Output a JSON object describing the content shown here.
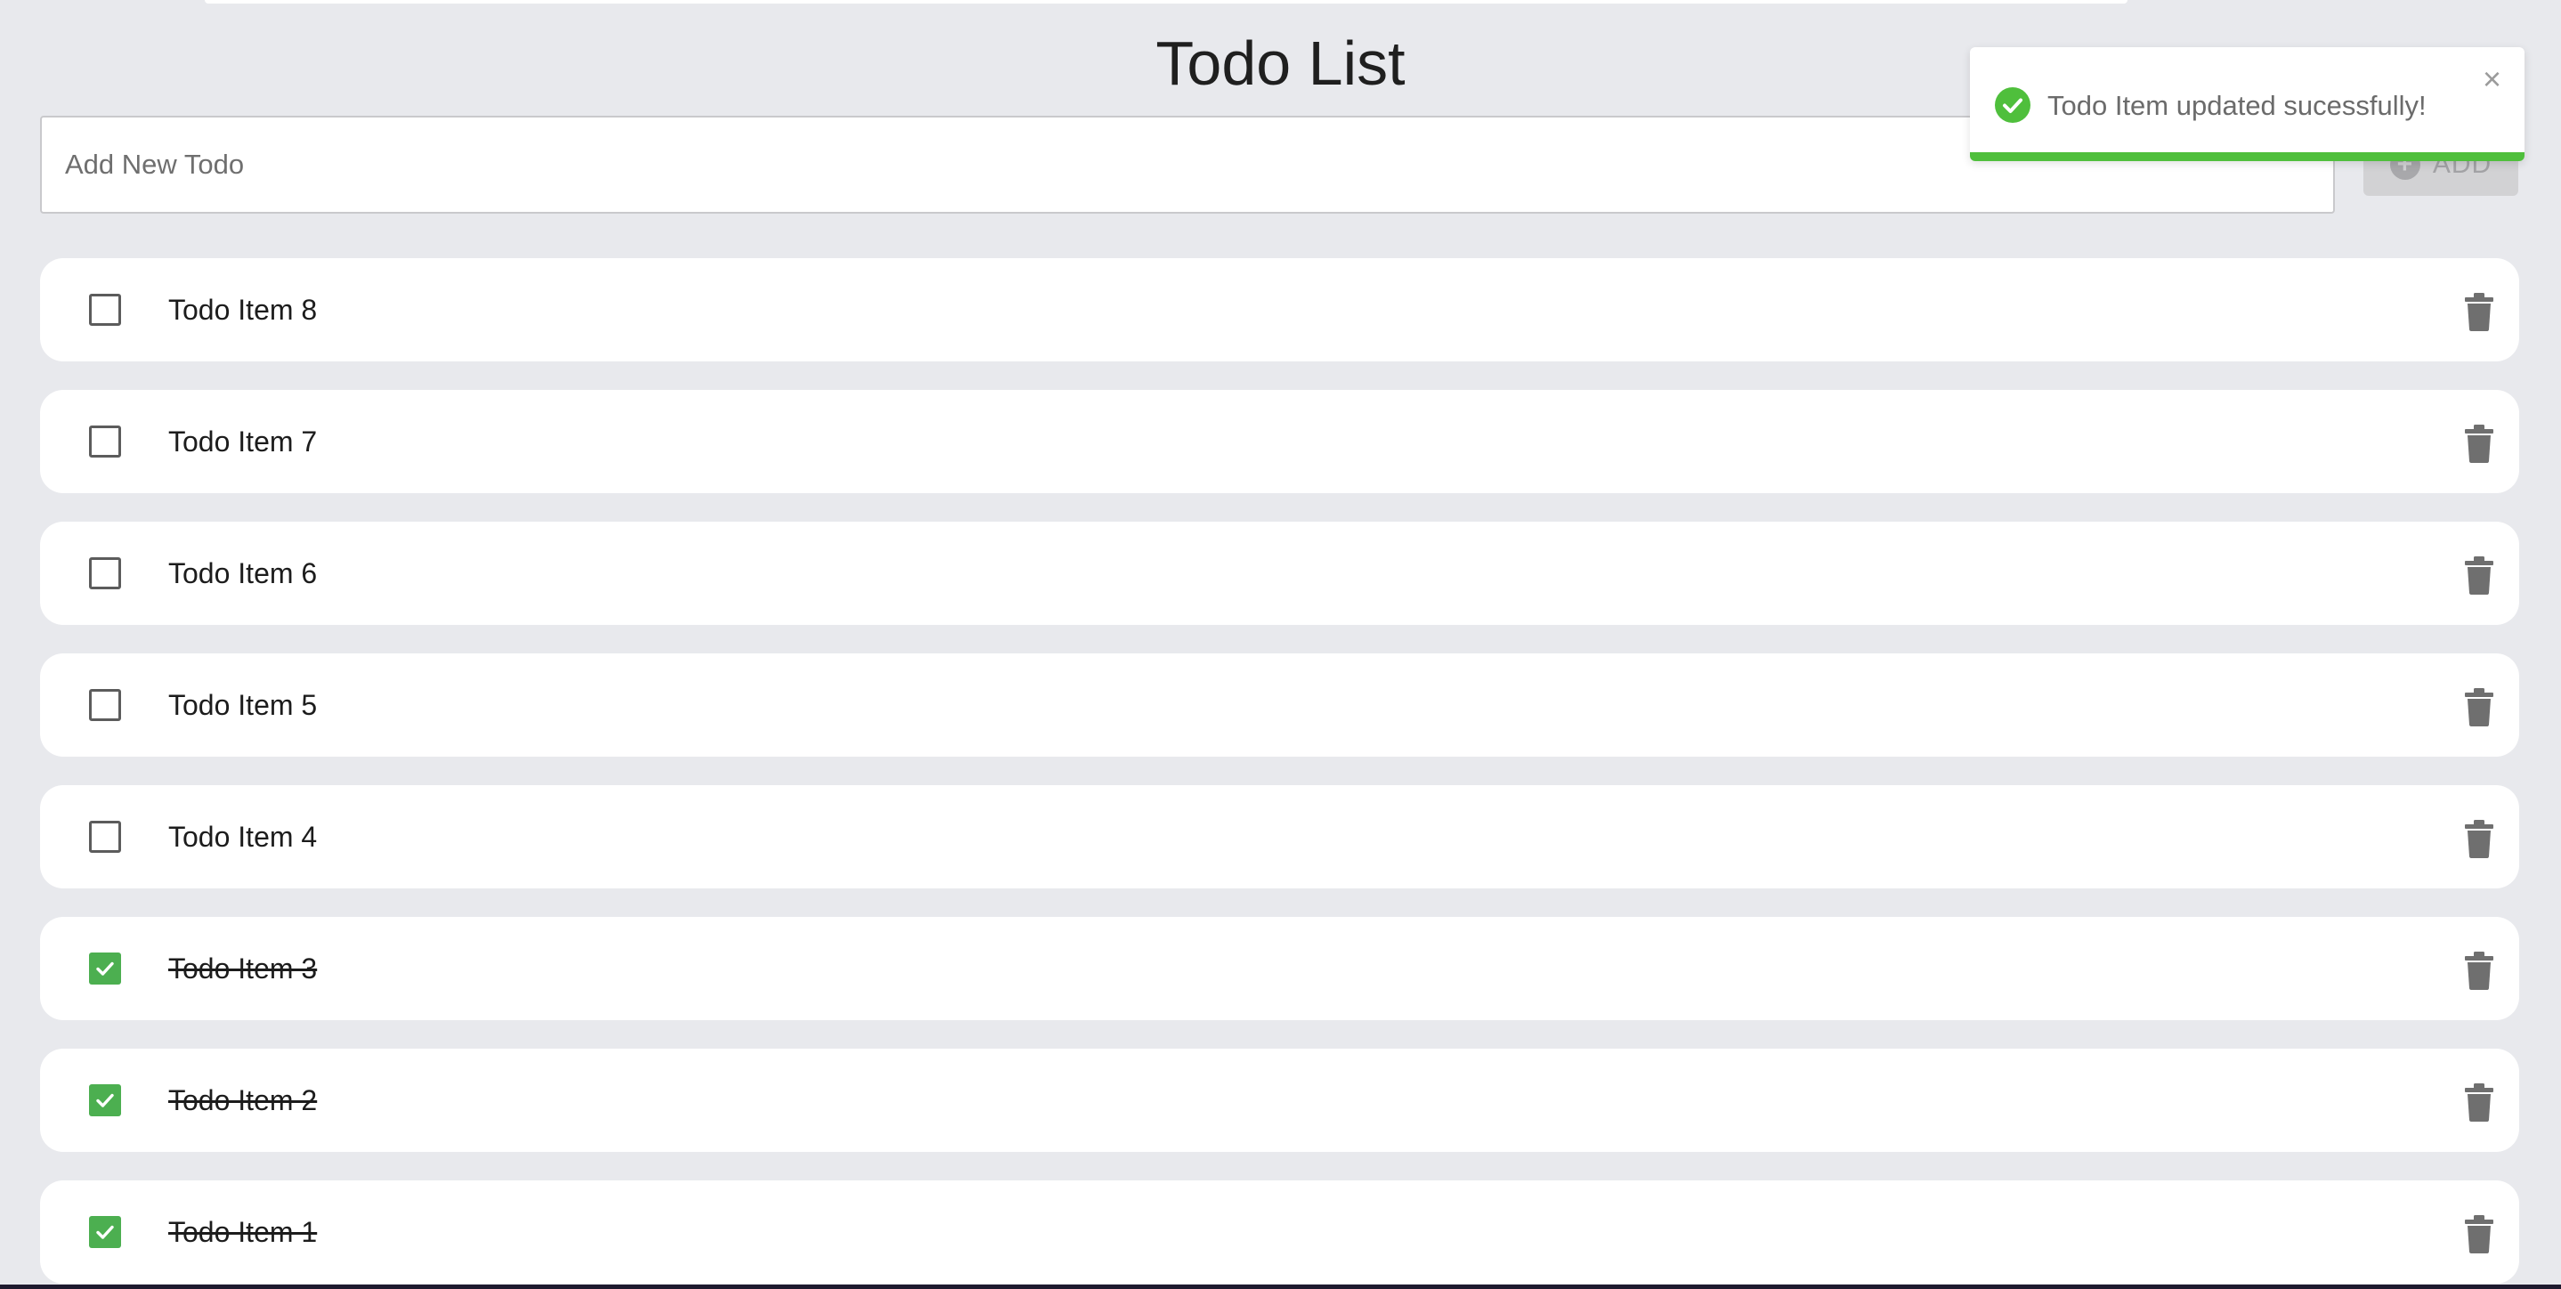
{
  "header": {
    "title": "Todo List"
  },
  "add_form": {
    "placeholder": "Add New Todo",
    "button_label": "ADD",
    "button_icon": "plus-circle-icon"
  },
  "todos": [
    {
      "label": "Todo Item 8",
      "completed": false
    },
    {
      "label": "Todo Item 7",
      "completed": false
    },
    {
      "label": "Todo Item 6",
      "completed": false
    },
    {
      "label": "Todo Item 5",
      "completed": false
    },
    {
      "label": "Todo Item 4",
      "completed": false
    },
    {
      "label": "Todo Item 3",
      "completed": true
    },
    {
      "label": "Todo Item 2",
      "completed": true
    },
    {
      "label": "Todo Item 1",
      "completed": true
    }
  ],
  "toast": {
    "message": "Todo Item updated sucessfully!",
    "close_glyph": "×",
    "progress": 1.0,
    "status": "success"
  },
  "colors": {
    "background": "#e8e9ed",
    "checked": "#4caf50",
    "success": "#4fbf3c",
    "trash": "#6f6f6f"
  }
}
